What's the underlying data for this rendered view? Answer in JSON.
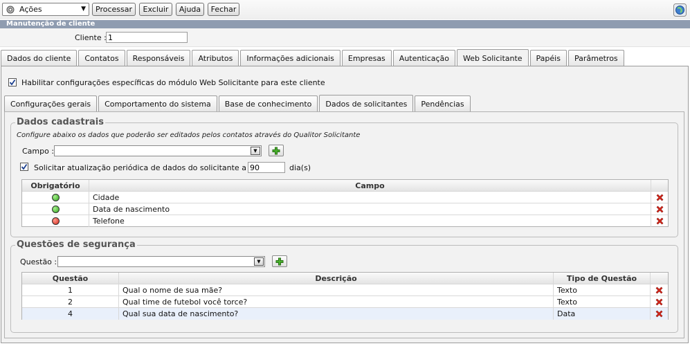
{
  "toolbar": {
    "actions_label": "Ações",
    "buttons": [
      "Processar",
      "Excluir",
      "Ajuda",
      "Fechar"
    ]
  },
  "header": {
    "title": "Manutenção de cliente",
    "cliente_label": "Cliente :",
    "cliente_value": "1"
  },
  "main_tabs": [
    "Dados do cliente",
    "Contatos",
    "Responsáveis",
    "Atributos",
    "Informações adicionais",
    "Empresas",
    "Autenticação",
    "Web Solicitante",
    "Papéis",
    "Parâmetros"
  ],
  "habilitar_label": "Habilitar configurações específicas do módulo Web Solicitante para este cliente",
  "sub_tabs": [
    "Configurações gerais",
    "Comportamento do sistema",
    "Base de conhecimento",
    "Dados de solicitantes",
    "Pendências"
  ],
  "dados_cadastrais": {
    "legend": "Dados cadastrais",
    "hint": "Configure abaixo os dados que poderão ser editados pelos contatos através do Qualitor Solicitante",
    "campo_label": "Campo :",
    "solicitar_label": "Solicitar atualização periódica de dados do solicitante a cada",
    "dias_value": "90",
    "dias_unit": "dia(s)",
    "columns": [
      "Obrigatório",
      "Campo"
    ],
    "rows": [
      {
        "status": "green",
        "campo": "Cidade"
      },
      {
        "status": "green",
        "campo": "Data de nascimento"
      },
      {
        "status": "red",
        "campo": "Telefone"
      }
    ]
  },
  "questoes": {
    "legend": "Questões de segurança",
    "questao_label": "Questão :",
    "columns": [
      "Questão",
      "Descrição",
      "Tipo de Questão"
    ],
    "rows": [
      {
        "num": "1",
        "descricao": "Qual o nome de sua mãe?",
        "tipo": "Texto"
      },
      {
        "num": "2",
        "descricao": "Qual time de futebol você torce?",
        "tipo": "Texto"
      },
      {
        "num": "4",
        "descricao": "Qual sua data de nascimento?",
        "tipo": "Data"
      }
    ]
  },
  "colors": {
    "title_bar": "#8f9cb0",
    "status_green": "#2ea31a",
    "status_red": "#d3261a"
  }
}
